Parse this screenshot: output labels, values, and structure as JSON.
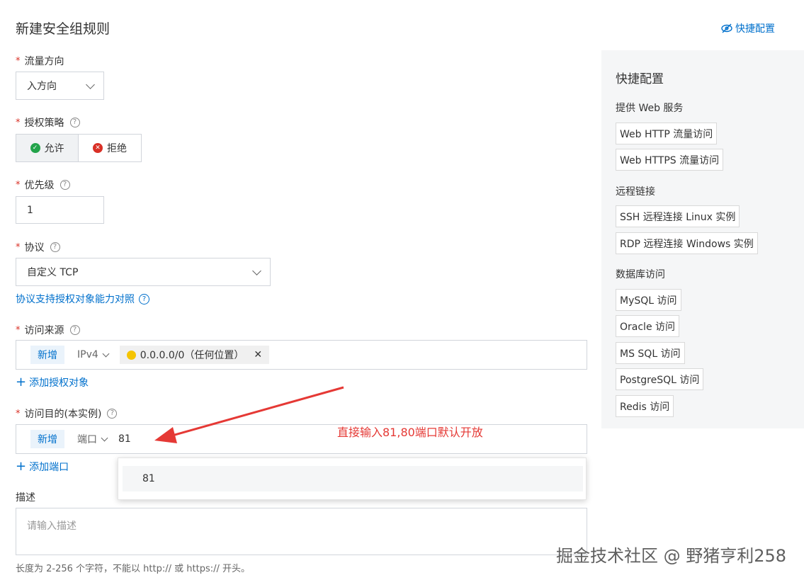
{
  "page": {
    "title": "新建安全组规则",
    "quick_config_link": "快捷配置"
  },
  "form": {
    "direction": {
      "label": "流量方向",
      "value": "入方向"
    },
    "policy": {
      "label": "授权策略",
      "allow": "允许",
      "deny": "拒绝"
    },
    "priority": {
      "label": "优先级",
      "value": "1"
    },
    "protocol": {
      "label": "协议",
      "value": "自定义 TCP",
      "support_link": "协议支持授权对象能力对照"
    },
    "source": {
      "label": "访问来源",
      "new_tag": "新增",
      "ip_type": "IPv4",
      "chip_text": "0.0.0.0/0（任何位置）",
      "add_link": "添加授权对象"
    },
    "destination": {
      "label": "访问目的(本实例)",
      "new_tag": "新增",
      "type": "端口",
      "typed_value": "81",
      "add_link": "添加端口"
    },
    "description": {
      "label": "描述",
      "placeholder": "请输入描述",
      "hint": "长度为 2-256 个字符，不能以 http:// 或 https:// 开头。"
    }
  },
  "dropdown": {
    "items": [
      "81"
    ]
  },
  "annotation": "直接输入81,80端口默认开放",
  "quick_panel": {
    "title": "快捷配置",
    "groups": [
      {
        "title": "提供 Web 服务",
        "items": [
          "Web HTTP 流量访问",
          "Web HTTPS 流量访问"
        ]
      },
      {
        "title": "远程链接",
        "items": [
          "SSH 远程连接 Linux 实例",
          "RDP 远程连接 Windows 实例"
        ]
      },
      {
        "title": "数据库访问",
        "items": [
          "MySQL 访问",
          "Oracle 访问",
          "MS SQL 访问",
          "PostgreSQL 访问",
          "Redis 访问"
        ]
      }
    ]
  },
  "watermark": "掘金技术社区 @ 野猪亨利258",
  "colors": {
    "link": "#0070cc",
    "required": "#d93026",
    "allow_green": "#22a34a",
    "deny_red": "#d93026",
    "annotation_red": "#e53935"
  }
}
